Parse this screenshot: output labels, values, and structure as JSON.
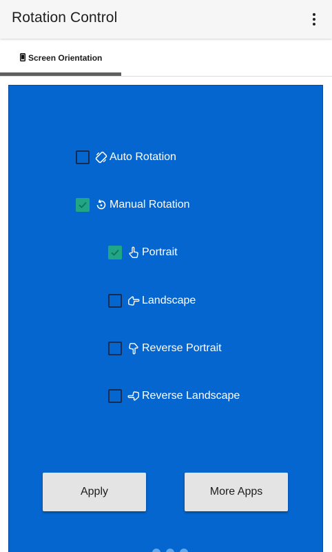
{
  "app": {
    "title": "Rotation Control"
  },
  "toolbar": {
    "overflow_icon": "more-vert-icon"
  },
  "tabs": [
    {
      "label": "Screen Orientation",
      "icon": "phone-icon",
      "selected": true
    }
  ],
  "options": {
    "auto_rotation": {
      "label": "Auto Rotation",
      "checked": false,
      "icon": "screen-rotation-icon"
    },
    "manual_rotation": {
      "label": "Manual Rotation",
      "checked": true,
      "icon": "manual-rotation-icon"
    },
    "portrait": {
      "label": "Portrait",
      "checked": true,
      "icon": "hand-point-up-icon"
    },
    "landscape": {
      "label": "Landscape",
      "checked": false,
      "icon": "hand-point-right-icon"
    },
    "reverse_portrait": {
      "label": "Reverse Portrait",
      "checked": false,
      "icon": "hand-point-down-icon"
    },
    "reverse_landscape": {
      "label": "Reverse Landscape",
      "checked": false,
      "icon": "hand-point-left-icon"
    }
  },
  "buttons": {
    "apply": "Apply",
    "more_apps": "More Apps"
  },
  "colors": {
    "panel": "#0666cf",
    "checkbox_checked": "#21a685",
    "toolbar": "#f6f6f6"
  }
}
